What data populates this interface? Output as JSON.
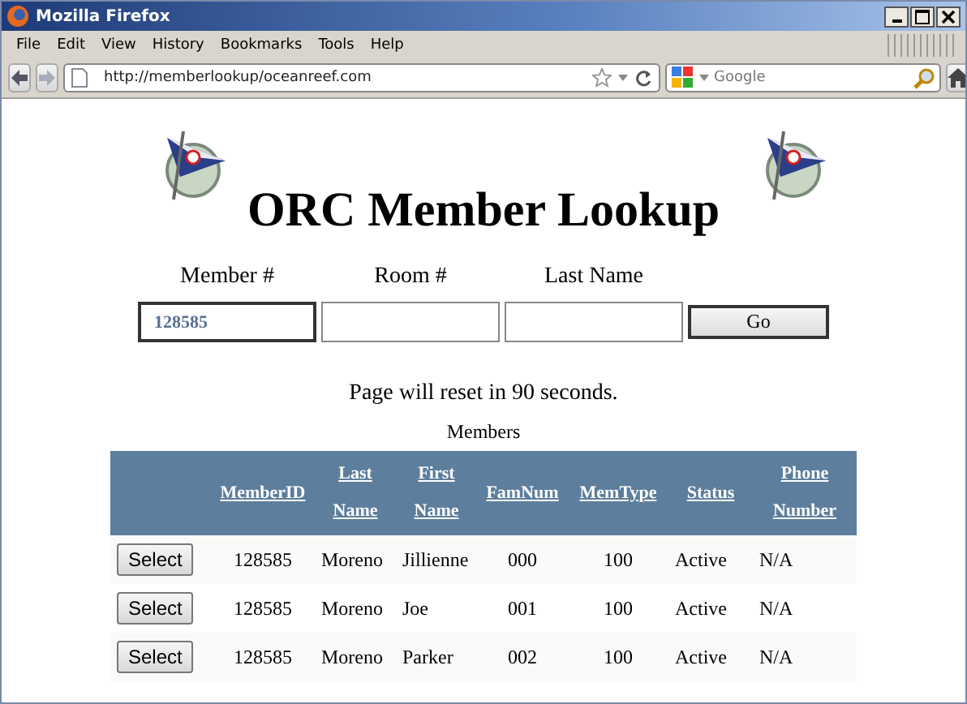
{
  "window": {
    "title": "Mozilla Firefox"
  },
  "menu": [
    "File",
    "Edit",
    "View",
    "History",
    "Bookmarks",
    "Tools",
    "Help"
  ],
  "address_bar": {
    "value": "http://memberlookup/oceanreef.com"
  },
  "search": {
    "placeholder": "Google"
  },
  "page": {
    "title": "ORC Member Lookup",
    "fields": [
      {
        "label": "Member #",
        "value": "128585"
      },
      {
        "label": "Room #"
      },
      {
        "label": "Last Name"
      }
    ],
    "go_button": "Go",
    "notice": "Page will reset in 90 seconds.",
    "table": {
      "caption": "Members",
      "columns": [
        "",
        "MemberID",
        "Last Name",
        "First Name",
        "FamNum",
        "MemType",
        "Status",
        "Phone Number"
      ],
      "rows": [
        {
          "cells": [
            "Select",
            "128585",
            "Moreno",
            "Jillienne",
            "000",
            "100",
            "Active",
            "N/A"
          ]
        },
        {
          "cells": [
            "Select",
            "128585",
            "Moreno",
            "Joe",
            "001",
            "100",
            "Active",
            "N/A"
          ]
        },
        {
          "cells": [
            "Select",
            "128585",
            "Moreno",
            "Parker",
            "002",
            "100",
            "Active",
            "N/A"
          ]
        }
      ]
    }
  }
}
